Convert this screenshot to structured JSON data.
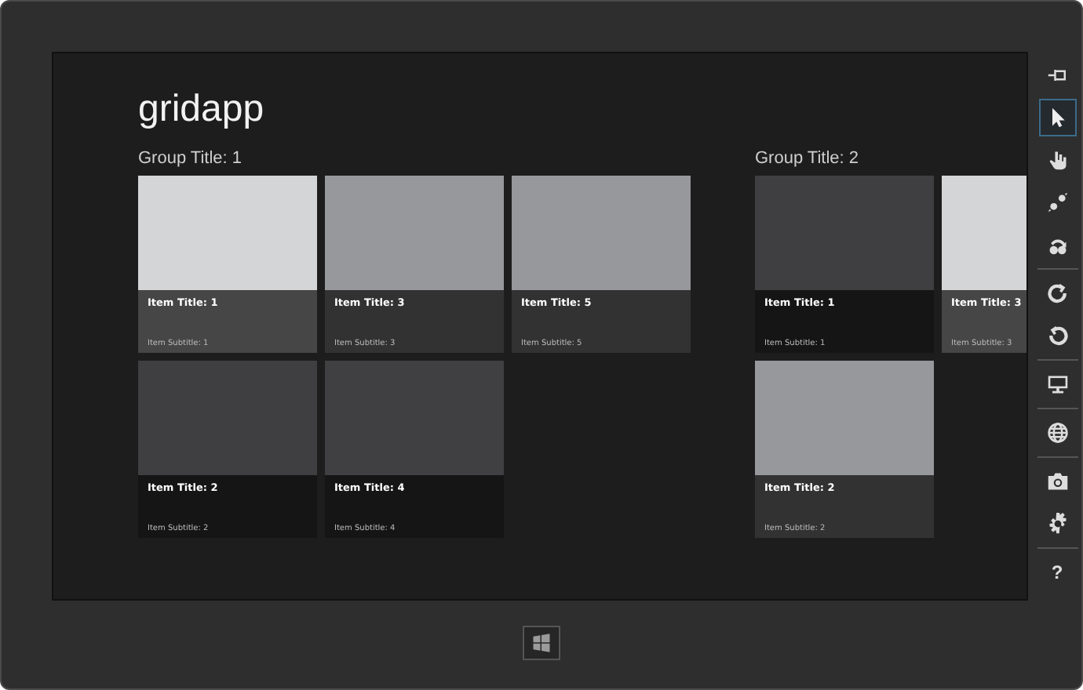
{
  "app": {
    "title": "gridapp"
  },
  "groups": [
    {
      "title": "Group Title: 1",
      "items": [
        {
          "title": "Item Title: 1",
          "subtitle": "Item Subtitle: 1",
          "color": "#d4d5d7"
        },
        {
          "title": "Item Title: 2",
          "subtitle": "Item Subtitle: 2",
          "color": "#3f3f41"
        },
        {
          "title": "Item Title: 3",
          "subtitle": "Item Subtitle: 3",
          "color": "#97989c"
        },
        {
          "title": "Item Title: 4",
          "subtitle": "Item Subtitle: 4",
          "color": "#404042"
        },
        {
          "title": "Item Title: 5",
          "subtitle": "Item Subtitle: 5",
          "color": "#97989c"
        }
      ]
    },
    {
      "title": "Group Title: 2",
      "items": [
        {
          "title": "Item Title: 1",
          "subtitle": "Item Subtitle: 1",
          "color": "#3f3f41"
        },
        {
          "title": "Item Title: 2",
          "subtitle": "Item Subtitle: 2",
          "color": "#97989c"
        },
        {
          "title": "Item Title: 3",
          "subtitle": "Item Subtitle: 3",
          "color": "#d4d5d7"
        }
      ]
    }
  ],
  "toolbar": {
    "tools": [
      {
        "selected": false
      },
      {
        "selected": true
      },
      {
        "selected": false
      },
      {
        "selected": false
      },
      {
        "selected": false
      },
      {
        "selected": false
      },
      {
        "selected": false
      },
      {
        "selected": false
      },
      {
        "selected": false
      },
      {
        "selected": false
      },
      {
        "selected": false
      },
      {
        "selected": false,
        "label": "?"
      }
    ]
  }
}
